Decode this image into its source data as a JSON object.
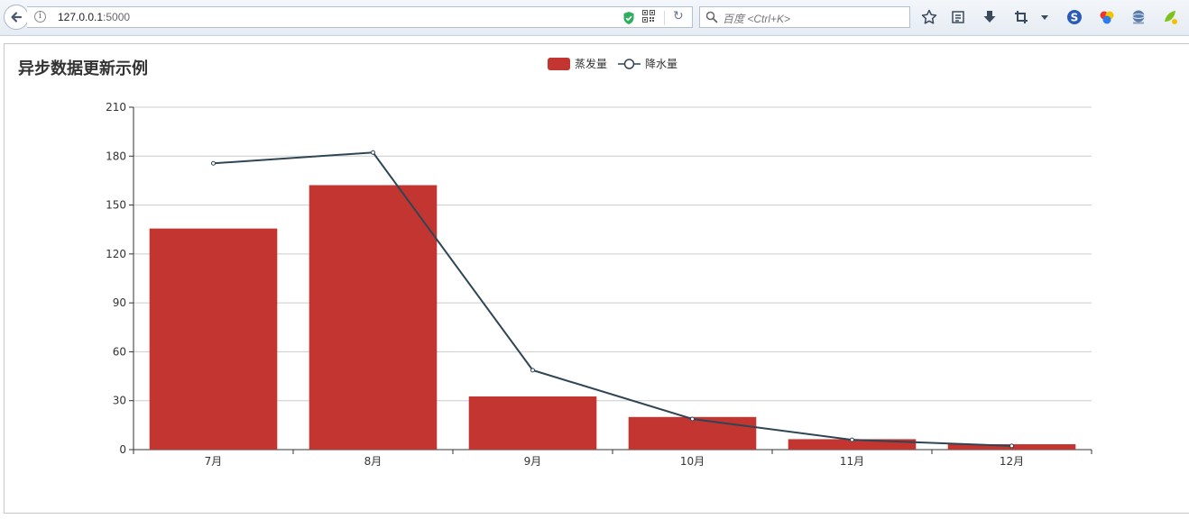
{
  "browser": {
    "url_host": "127.0.0.1",
    "url_port": ":5000",
    "search_placeholder": "百度 <Ctrl+K>"
  },
  "chart_title": "异步数据更新示例",
  "chart_data": {
    "type": "bar",
    "categories": [
      "7月",
      "8月",
      "9月",
      "10月",
      "11月",
      "12月"
    ],
    "series": [
      {
        "name": "蒸发量",
        "type": "bar",
        "color": "#c23531",
        "values": [
          135.6,
          162.2,
          32.6,
          20.0,
          6.4,
          3.3
        ]
      },
      {
        "name": "降水量",
        "type": "line",
        "color": "#2f4554",
        "values": [
          175.6,
          182.2,
          48.7,
          18.8,
          6.0,
          2.3
        ]
      }
    ],
    "y_ticks": [
      "0",
      "30",
      "60",
      "90",
      "120",
      "150",
      "180",
      "210"
    ],
    "ylim": [
      0,
      210
    ],
    "grid": true,
    "legend_position": "top-center"
  }
}
